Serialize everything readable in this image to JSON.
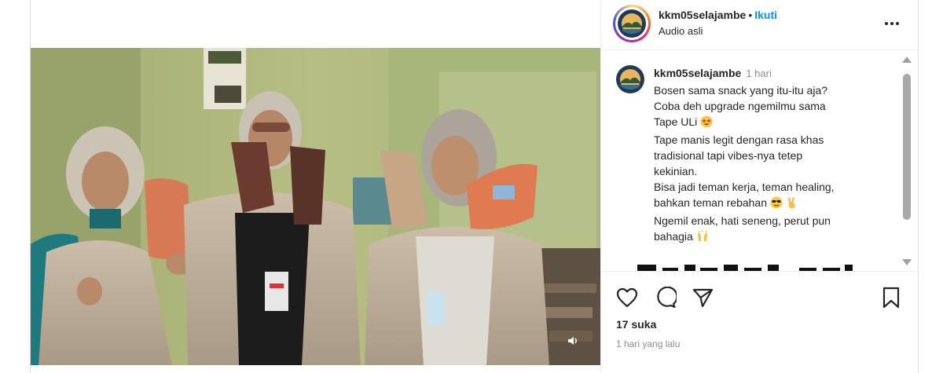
{
  "header": {
    "username": "kkm05selajambe",
    "separator": "•",
    "follow_label": "Ikuti",
    "audio_label": "Audio asli"
  },
  "caption": {
    "username": "kkm05selajambe",
    "time": "1 hari",
    "lines": [
      "Bosen sama snack yang itu-itu aja?",
      "Coba deh upgrade ngemilmu sama",
      "Tape ULi",
      "Tape manis legit dengan rasa khas",
      "tradisional tapi vibes-nya tetep",
      "kekinian.",
      "Bisa jadi teman kerja, teman healing,",
      "bahkan teman rebahan",
      "Ngemil enak, hati seneng, perut pun",
      "bahagia"
    ],
    "emojis": [
      "star-struck-emoji",
      "sunglasses-emoji",
      "victory-hand-emoji",
      "raising-hands-emoji"
    ]
  },
  "actions": {
    "likes": "17 suka",
    "time_ago": "1 hari yang lalu"
  },
  "icons": {
    "like": "heart-icon",
    "comment": "comment-icon",
    "share": "share-icon",
    "save": "bookmark-icon",
    "more": "more-options-icon",
    "mute": "speaker-icon"
  },
  "colors": {
    "follow": "#0095f6",
    "secondary_text": "#8e8e8e",
    "border": "#dbdbdb"
  }
}
